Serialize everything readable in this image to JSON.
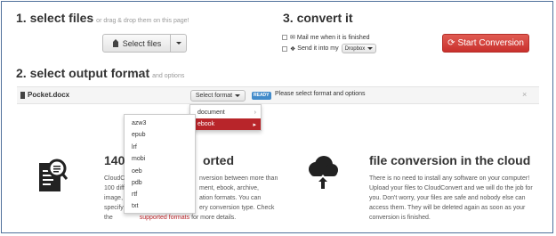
{
  "step1": {
    "title": "1. select files",
    "subtitle": "or drag & drop them on this page!",
    "select_files_label": "Select files"
  },
  "step3": {
    "title": "3. convert it",
    "mail_label": "Mail me when it is finished",
    "send_label": "Send it into my",
    "dropbox_label": "Dropbox",
    "start_label": "Start Conversion"
  },
  "step2": {
    "title": "2. select output format",
    "subtitle": "and options"
  },
  "file": {
    "name": "Pocket.docx",
    "select_format_label": "Select format",
    "ready_badge": "READY",
    "status_text": "Please select format and options",
    "close_symbol": "×"
  },
  "format_menu": {
    "items": [
      {
        "label": "document",
        "arrow": "›"
      },
      {
        "label": "ebook",
        "arrow": "▸"
      }
    ]
  },
  "ebook_menu": {
    "items": [
      "azw3",
      "epub",
      "lrf",
      "mobi",
      "oeb",
      "pdb",
      "rtf",
      "txt"
    ]
  },
  "feature_left": {
    "title_start": "140",
    "title_end": "orted",
    "lines": [
      {
        "start": "CloudC",
        "end": "nversion between more than"
      },
      {
        "start": "100 diff",
        "end": "ment, ebook, archive,"
      },
      {
        "start": "image,",
        "end": "ation formats. You can"
      },
      {
        "start": "specify",
        "end": "ery conversion type. Check"
      }
    ],
    "last_line_start": "the",
    "link_text": "supported formats",
    "last_line_end": "for more details."
  },
  "feature_right": {
    "title": "file conversion in the cloud",
    "lines": [
      "There is no need to install any software on your computer!",
      "Upload your files to CloudConvert and we will do the job for",
      "you. Don't worry, your files are safe and nobody else can",
      "access them. They will be deleted again as soon as your",
      "conversion is finished."
    ]
  },
  "colors": {
    "accent_red": "#c9302c",
    "ready_blue": "#428bca",
    "highlight_red": "#b8252a"
  }
}
